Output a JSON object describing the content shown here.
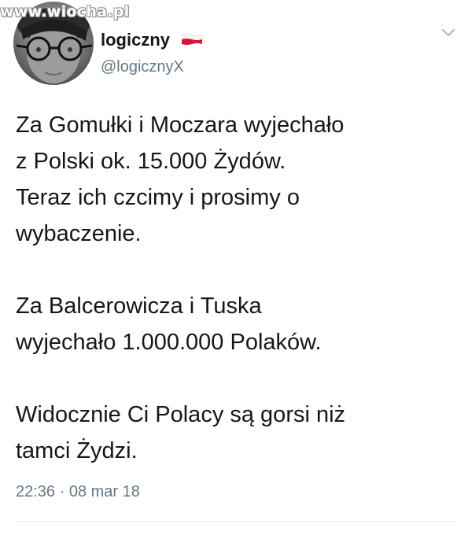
{
  "watermark": "www.wiocha.pl",
  "tweet": {
    "author": {
      "display_name": "logiczny",
      "handle": "@logicznyX"
    },
    "paragraphs": [
      "Za Gomułki i Moczara wyjechało\nz Polski ok. 15.000 Żydów.\nTeraz ich czcimy i prosimy o\nwybaczenie.",
      "Za Balcerowicza i Tuska\nwyjechało 1.000.000 Polaków.",
      "Widocznie Ci Polacy są gorsi niż\ntamci Żydzi."
    ],
    "timestamp": "22:36 · 08 mar 18"
  },
  "icons": {
    "flag": "poland-flag-icon",
    "menu": "chevron-down-icon"
  },
  "colors": {
    "text": "#14171a",
    "secondary": "#657786",
    "flag_red": "#dc143c",
    "divider": "#e1e8ed"
  }
}
